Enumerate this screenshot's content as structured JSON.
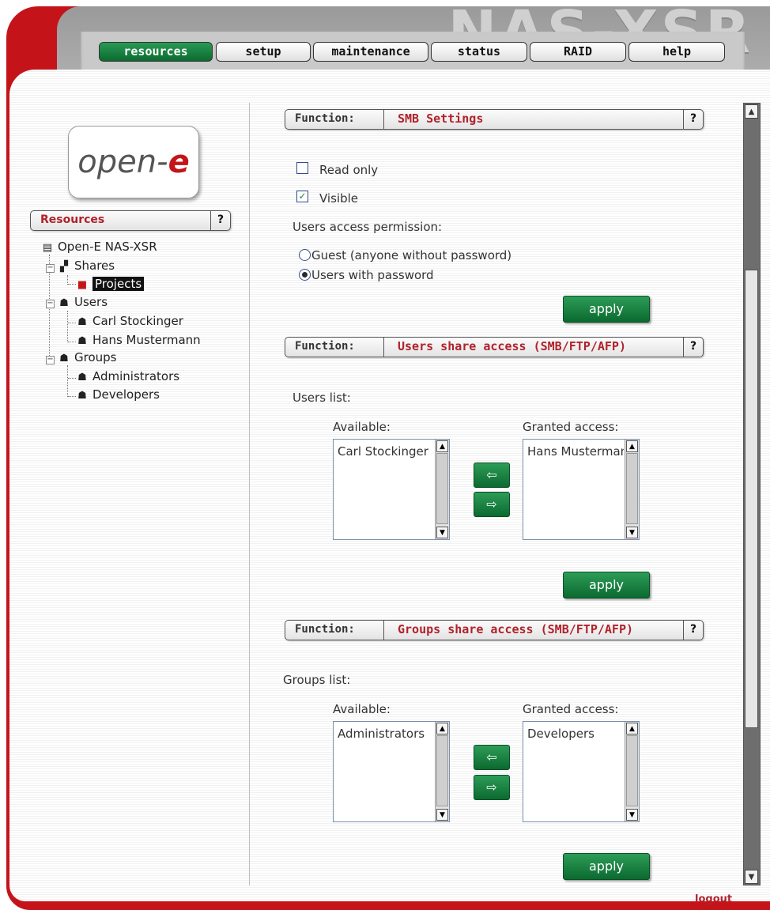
{
  "brand": "NAS-XSR",
  "nav": {
    "tabs": [
      "resources",
      "setup",
      "maintenance",
      "status",
      "RAID",
      "help"
    ],
    "active": "resources"
  },
  "logo": {
    "text_main": "open-",
    "text_accent": "e"
  },
  "sidebar": {
    "header": "Resources",
    "help": "?",
    "tree": {
      "root": "Open-E NAS-XSR",
      "shares": "Shares",
      "share_items": [
        "Projects"
      ],
      "users": "Users",
      "user_items": [
        "Carl Stockinger",
        "Hans Mustermann"
      ],
      "groups": "Groups",
      "group_items": [
        "Administrators",
        "Developers"
      ]
    }
  },
  "smb": {
    "function_label": "Function:",
    "title": "SMB Settings",
    "help": "?",
    "read_only_label": "Read only",
    "read_only": false,
    "visible_label": "Visible",
    "visible": true,
    "permission_label": "Users access permission:",
    "options": [
      "Guest (anyone without password)",
      "Users with password"
    ],
    "selected_option": "Users with password",
    "apply": "apply"
  },
  "users_access": {
    "function_label": "Function:",
    "title": "Users share access (SMB/FTP/AFP)",
    "help": "?",
    "list_label": "Users list:",
    "available_label": "Available:",
    "granted_label": "Granted access:",
    "available": [
      "Carl Stockinger"
    ],
    "granted": [
      "Hans Mustermann"
    ],
    "apply": "apply"
  },
  "groups_access": {
    "function_label": "Function:",
    "title": "Groups share access (SMB/FTP/AFP)",
    "help": "?",
    "list_label": "Groups list:",
    "available_label": "Available:",
    "granted_label": "Granted access:",
    "available": [
      "Administrators"
    ],
    "granted": [
      "Developers"
    ],
    "apply": "apply"
  },
  "logout": "logout",
  "colors": {
    "frame_red": "#c4141a",
    "accent_green": "#0b6a30",
    "title_red": "#b0222b"
  }
}
